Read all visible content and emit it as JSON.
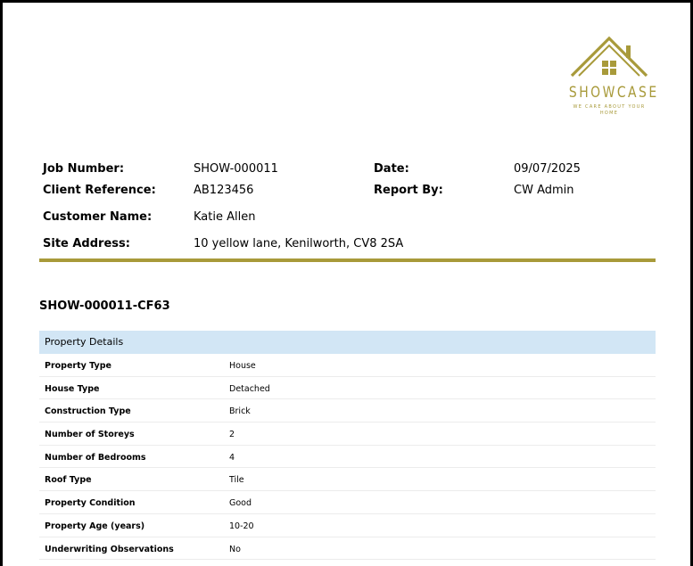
{
  "brand": {
    "name": "SHOWCASE",
    "tagline": "WE CARE ABOUT YOUR HOME",
    "gold_color": "#a89a3a"
  },
  "job": {
    "job_number_label": "Job Number:",
    "job_number": "SHOW-000011",
    "date_label": "Date:",
    "date": "09/07/2025",
    "client_ref_label": "Client Reference:",
    "client_ref": "AB123456",
    "report_by_label": "Report By:",
    "report_by": "CW Admin",
    "customer_label": "Customer Name:",
    "customer": "Katie Allen",
    "site_label": "Site Address:",
    "site": "10 yellow lane, Kenilworth, CV8 2SA"
  },
  "report_ref": "SHOW-000011-CF63",
  "property": {
    "heading": "Property Details",
    "header_color": "#d2e6f5",
    "rows": [
      {
        "label": "Property Type",
        "value": "House"
      },
      {
        "label": "House Type",
        "value": "Detached"
      },
      {
        "label": "Construction Type",
        "value": "Brick"
      },
      {
        "label": "Number of Storeys",
        "value": "2"
      },
      {
        "label": "Number of Bedrooms",
        "value": "4"
      },
      {
        "label": "Roof Type",
        "value": "Tile"
      },
      {
        "label": "Property Condition",
        "value": "Good"
      },
      {
        "label": "Property Age (years)",
        "value": "10-20"
      },
      {
        "label": "Underwriting Observations",
        "value": "No"
      }
    ]
  }
}
